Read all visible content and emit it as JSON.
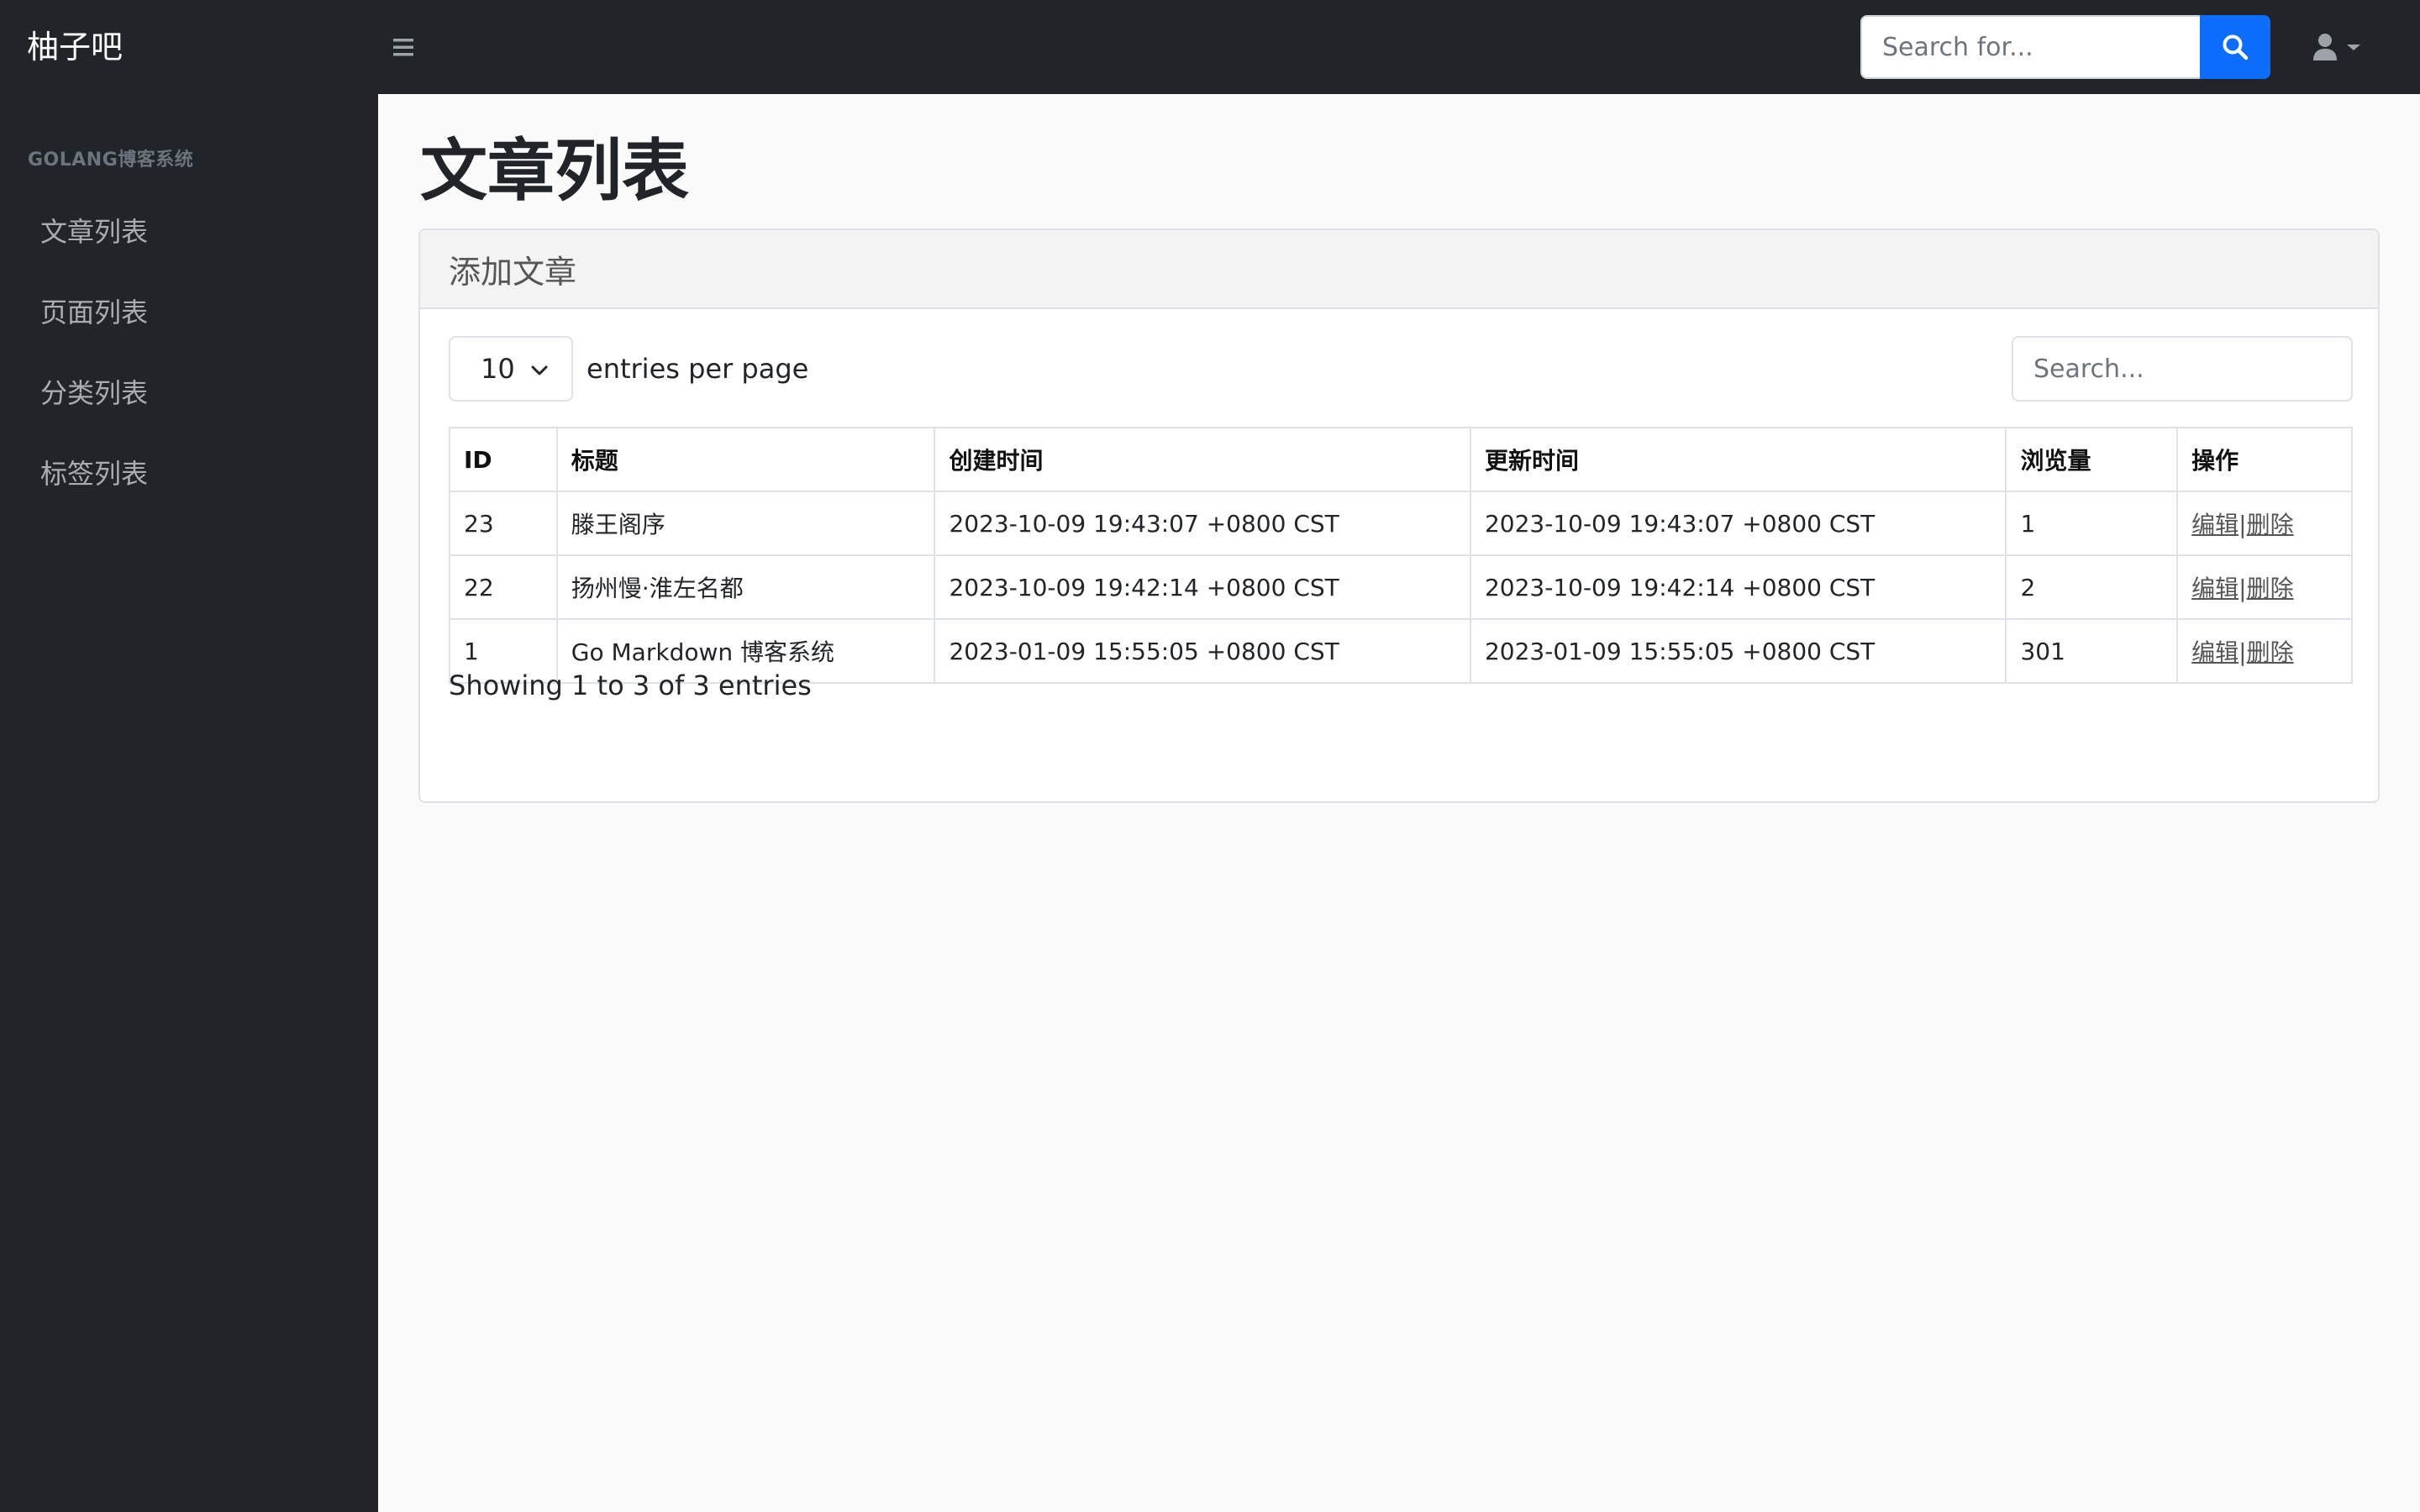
{
  "navbar": {
    "brand": "柚子吧",
    "search_placeholder": "Search for..."
  },
  "sidebar": {
    "heading": "GOLANG博客系统",
    "items": [
      {
        "label": "文章列表"
      },
      {
        "label": "页面列表"
      },
      {
        "label": "分类列表"
      },
      {
        "label": "标签列表"
      }
    ]
  },
  "main": {
    "title": "文章列表",
    "card_header_link": "添加文章",
    "per_page_value": "10",
    "per_page_label": "entries per page",
    "table_search_placeholder": "Search...",
    "table": {
      "headers": [
        "ID",
        "标题",
        "创建时间",
        "更新时间",
        "浏览量",
        "操作"
      ],
      "rows": [
        {
          "id": "23",
          "title": "滕王阁序",
          "created": "2023-10-09 19:43:07 +0800 CST",
          "updated": "2023-10-09 19:43:07 +0800 CST",
          "views": "1"
        },
        {
          "id": "22",
          "title": "扬州慢·淮左名都",
          "created": "2023-10-09 19:42:14 +0800 CST",
          "updated": "2023-10-09 19:42:14 +0800 CST",
          "views": "2"
        },
        {
          "id": "1",
          "title": "Go Markdown 博客系统",
          "created": "2023-01-09 15:55:05 +0800 CST",
          "updated": "2023-01-09 15:55:05 +0800 CST",
          "views": "301"
        }
      ],
      "edit_label": "编辑",
      "separator": "|",
      "delete_label": "删除"
    },
    "info": "Showing 1 to 3 of 3 entries"
  },
  "colors": {
    "dark_bg": "#212529",
    "accent": "#0d6efd",
    "page_bg": "#fafafa"
  },
  "icons": [
    "hamburger-icon",
    "search-icon",
    "user-icon",
    "caret-down-icon",
    "chevron-down-icon"
  ]
}
